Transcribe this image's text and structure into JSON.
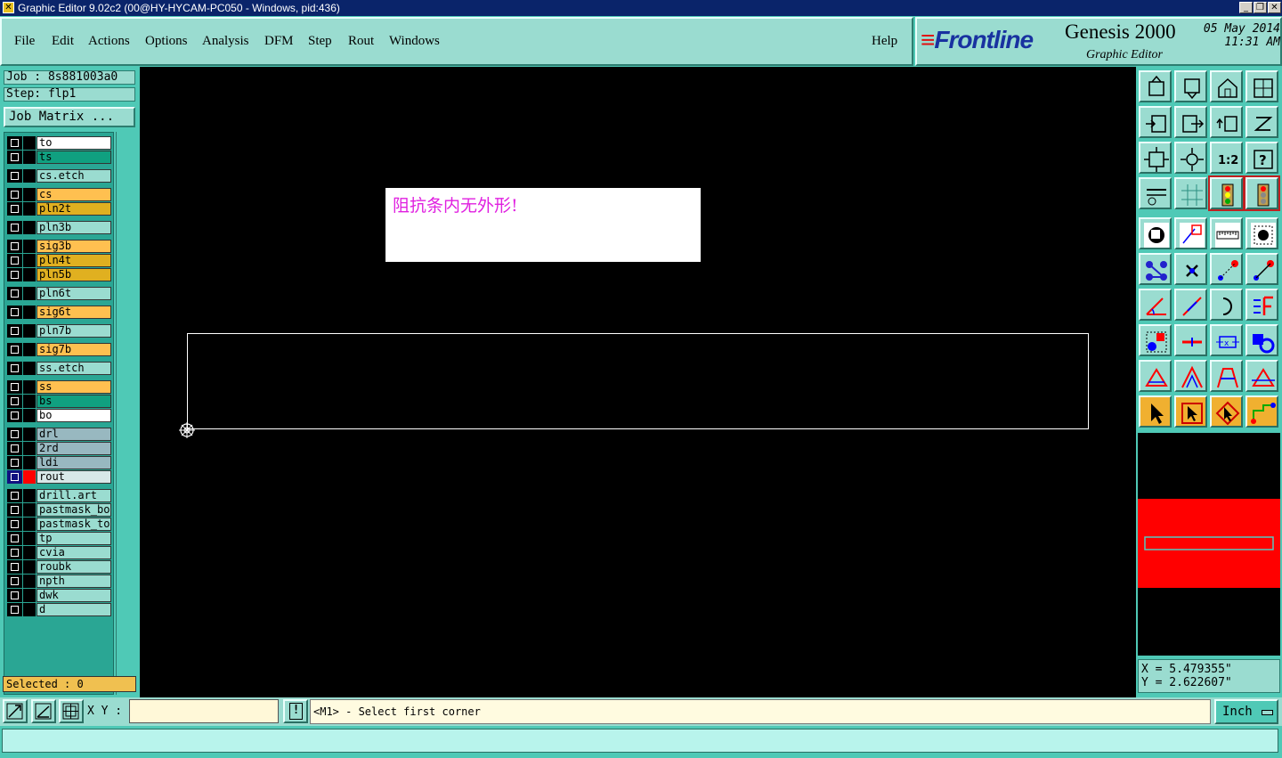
{
  "window": {
    "title": "Graphic Editor 9.02c2 (00@HY-HYCAM-PC050 - Windows, pid:436)",
    "app_icon": "x-icon",
    "controls": [
      "minimize",
      "restore",
      "close"
    ]
  },
  "menu": {
    "items": [
      "File",
      "Edit",
      "Actions",
      "Options",
      "Analysis",
      "DFM",
      "Step",
      "Rout",
      "Windows"
    ],
    "help": "Help"
  },
  "brand": {
    "logo": "Frontline",
    "product": "Genesis 2000",
    "subtitle": "Graphic Editor",
    "date": "05 May 2014",
    "time": "11:31 AM"
  },
  "job": {
    "job_label": "Job : 8s881003a0",
    "step_label": "Step: flp1",
    "matrix_button": "Job Matrix ...",
    "selected_label": "Selected : 0"
  },
  "layers": [
    {
      "name": "to",
      "color": "#ffffff"
    },
    {
      "name": "ts",
      "color": "#10a080"
    },
    {
      "name": "cs.etch",
      "color": "#9adcd0"
    },
    {
      "name": "cs",
      "color": "#ffc050"
    },
    {
      "name": "pln2t",
      "color": "#e0b020"
    },
    {
      "name": "pln3b",
      "color": "#9adcd0"
    },
    {
      "name": "sig3b",
      "color": "#ffc050"
    },
    {
      "name": "pln4t",
      "color": "#e0b020"
    },
    {
      "name": "pln5b",
      "color": "#e0b020"
    },
    {
      "name": "pln6t",
      "color": "#9adcd0"
    },
    {
      "name": "sig6t",
      "color": "#ffc050"
    },
    {
      "name": "pln7b",
      "color": "#9adcd0"
    },
    {
      "name": "sig7b",
      "color": "#ffc050"
    },
    {
      "name": "ss.etch",
      "color": "#9adcd0"
    },
    {
      "name": "ss",
      "color": "#ffc050"
    },
    {
      "name": "bs",
      "color": "#10a080"
    },
    {
      "name": "bo",
      "color": "#ffffff"
    },
    {
      "name": "drl",
      "color": "#98b8c0"
    },
    {
      "name": "2rd",
      "color": "#98b8c0"
    },
    {
      "name": "ldi",
      "color": "#98b8c0"
    },
    {
      "name": "rout",
      "color": "#d8e8e8",
      "affected": true
    },
    {
      "name": "drill.art",
      "color": "#9adcd0"
    },
    {
      "name": "pastmask_bot",
      "color": "#9adcd0"
    },
    {
      "name": "pastmask_top",
      "color": "#9adcd0"
    },
    {
      "name": "tp",
      "color": "#9adcd0"
    },
    {
      "name": "cvia",
      "color": "#9adcd0"
    },
    {
      "name": "roubk",
      "color": "#9adcd0"
    },
    {
      "name": "npth",
      "color": "#9adcd0"
    },
    {
      "name": "dwk",
      "color": "#9adcd0"
    },
    {
      "name": "d",
      "color": "#9adcd0"
    }
  ],
  "canvas": {
    "message": "阻抗条内无外形!",
    "message_color": "#e020e0",
    "background": "#000000"
  },
  "coords": {
    "x": "X = 5.479355\"",
    "y": "Y = 2.622607\""
  },
  "status": {
    "xy_label": "X Y :",
    "xy_value": "",
    "warn_label": "!",
    "prompt": "<M1> - Select first corner",
    "unit": "Inch"
  },
  "toolbar": [
    "open-step-icon",
    "close-step-icon",
    "home-icon",
    "split-window-icon",
    "import-icon",
    "export-icon",
    "undo-icon",
    "redo-icon",
    "zoom-fit-icon",
    "zoom-center-icon",
    "zoom-1to2-icon",
    "help-icon",
    "tools-icon",
    "grid-icon",
    "traffic-light-icon",
    "traffic-light-red-icon",
    "snap-icon",
    "draw-shape-icon",
    "ruler-icon",
    "pad-icon",
    "net-icon",
    "cross-icon",
    "measure-icon",
    "measure-point-icon",
    "angle-icon",
    "line-icon",
    "arc-icon",
    "text-icon",
    "move-icon",
    "midline-icon",
    "edit-box-icon",
    "shapes-icon",
    "triangle-icon",
    "mirror-icon",
    "polygon-icon",
    "flip-icon",
    "select-icon",
    "select-box-icon",
    "select-poly-icon",
    "route-icon"
  ]
}
